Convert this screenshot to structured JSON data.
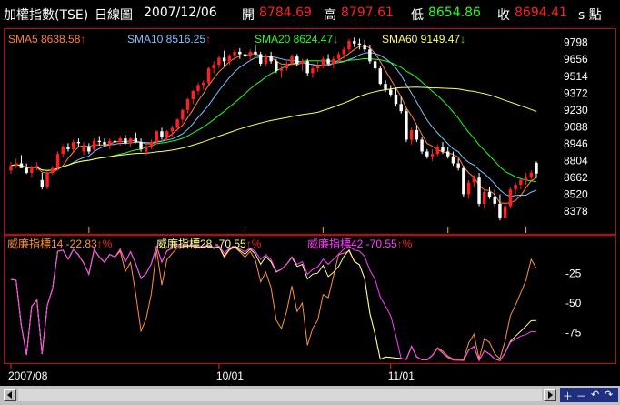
{
  "header": {
    "index_name": "加權指數(TSE)",
    "period": "日線圖",
    "date": "2007/12/06",
    "open_label": "開",
    "open_value": "8784.69",
    "high_label": "高",
    "high_value": "8797.61",
    "low_label": "低",
    "low_value": "8654.86",
    "close_label": "收",
    "close_value": "8694.41",
    "unit": "s 點"
  },
  "colors": {
    "up_candle": "#ff2020",
    "down_candle": "#ffffff",
    "sma5": "#ff8040",
    "sma10": "#80c0ff",
    "sma20": "#20ff20",
    "sma60": "#ffff60",
    "wr14": "#ff9040",
    "wr28": "#ffff90",
    "wr42": "#ff40ff",
    "frame": "#d00010",
    "axis_text": "#ffffff",
    "volume_tick": "#ffb000"
  },
  "icons": {
    "zoom_controls": [
      "zoom-in-icon",
      "zoom-out-icon",
      "undo-icon",
      "redo-icon"
    ]
  },
  "chart_data": [
    {
      "type": "candlestick",
      "legend": [
        {
          "name": "SMA5",
          "value": "8638.58",
          "arrow": "↑"
        },
        {
          "name": "SMA10",
          "value": "8516.25",
          "arrow": "↑"
        },
        {
          "name": "SMA20",
          "value": "8624.47",
          "arrow": "↓"
        },
        {
          "name": "SMA60",
          "value": "9149.47",
          "arrow": "↓"
        }
      ],
      "yticks": [
        9798,
        9656,
        9514,
        9372,
        9230,
        9088,
        8946,
        8804,
        8662,
        8520,
        8378
      ],
      "ylim": [
        8240,
        9880
      ],
      "xticks": [
        {
          "label": "2007/08",
          "index": 0
        },
        {
          "label": "10/01",
          "index": 40
        },
        {
          "label": "11/01",
          "index": 73
        }
      ],
      "candles": [
        [
          8720,
          8790,
          8690,
          8760
        ],
        [
          8760,
          8820,
          8740,
          8780
        ],
        [
          8780,
          8850,
          8760,
          8740
        ],
        [
          8740,
          8780,
          8690,
          8700
        ],
        [
          8700,
          8760,
          8660,
          8750
        ],
        [
          8750,
          8790,
          8720,
          8760
        ],
        [
          8640,
          8700,
          8560,
          8580
        ],
        [
          8580,
          8720,
          8560,
          8700
        ],
        [
          8700,
          8760,
          8680,
          8740
        ],
        [
          8740,
          8880,
          8720,
          8860
        ],
        [
          8860,
          8940,
          8830,
          8920
        ],
        [
          8920,
          8950,
          8880,
          8900
        ],
        [
          8900,
          8980,
          8880,
          8960
        ],
        [
          8960,
          8990,
          8920,
          8950
        ],
        [
          8880,
          8960,
          8850,
          8920
        ],
        [
          8920,
          8950,
          8860,
          8880
        ],
        [
          8900,
          8990,
          8880,
          8970
        ],
        [
          8970,
          9010,
          8930,
          8960
        ],
        [
          8960,
          8990,
          8920,
          8940
        ],
        [
          8940,
          8990,
          8900,
          8970
        ],
        [
          8970,
          9000,
          8930,
          8960
        ],
        [
          8960,
          9010,
          8930,
          8990
        ],
        [
          8990,
          9020,
          8940,
          8950
        ],
        [
          8950,
          9000,
          8920,
          8990
        ],
        [
          8990,
          9040,
          8950,
          8960
        ],
        [
          8960,
          8990,
          8880,
          8900
        ],
        [
          8880,
          8940,
          8850,
          8920
        ],
        [
          8920,
          8980,
          8900,
          8960
        ],
        [
          8960,
          9060,
          8940,
          9050
        ],
        [
          9050,
          9080,
          8980,
          9000
        ],
        [
          9000,
          9060,
          8970,
          9050
        ],
        [
          9050,
          9100,
          9000,
          9080
        ],
        [
          9080,
          9160,
          9050,
          9150
        ],
        [
          9150,
          9240,
          9120,
          9230
        ],
        [
          9230,
          9330,
          9200,
          9320
        ],
        [
          9320,
          9400,
          9280,
          9390
        ],
        [
          9390,
          9460,
          9360,
          9440
        ],
        [
          9440,
          9480,
          9400,
          9460
        ],
        [
          9460,
          9590,
          9440,
          9580
        ],
        [
          9580,
          9640,
          9540,
          9610
        ],
        [
          9610,
          9690,
          9580,
          9670
        ],
        [
          9670,
          9730,
          9600,
          9640
        ],
        [
          9640,
          9700,
          9610,
          9690
        ],
        [
          9690,
          9740,
          9650,
          9720
        ],
        [
          9720,
          9750,
          9660,
          9700
        ],
        [
          9700,
          9760,
          9660,
          9680
        ],
        [
          9680,
          9740,
          9640,
          9720
        ],
        [
          9720,
          9780,
          9690,
          9700
        ],
        [
          9700,
          9720,
          9600,
          9620
        ],
        [
          9620,
          9700,
          9600,
          9680
        ],
        [
          9680,
          9720,
          9620,
          9640
        ],
        [
          9640,
          9660,
          9540,
          9560
        ],
        [
          9560,
          9600,
          9500,
          9580
        ],
        [
          9580,
          9640,
          9560,
          9620
        ],
        [
          9620,
          9700,
          9600,
          9680
        ],
        [
          9680,
          9700,
          9600,
          9620
        ],
        [
          9620,
          9660,
          9560,
          9640
        ],
        [
          9640,
          9660,
          9520,
          9540
        ],
        [
          9540,
          9600,
          9500,
          9580
        ],
        [
          9580,
          9640,
          9550,
          9600
        ],
        [
          9600,
          9680,
          9580,
          9660
        ],
        [
          9660,
          9700,
          9600,
          9620
        ],
        [
          9620,
          9680,
          9580,
          9660
        ],
        [
          9660,
          9720,
          9620,
          9700
        ],
        [
          9700,
          9760,
          9660,
          9740
        ],
        [
          9740,
          9830,
          9720,
          9810
        ],
        [
          9810,
          9840,
          9760,
          9790
        ],
        [
          9790,
          9830,
          9740,
          9780
        ],
        [
          9780,
          9820,
          9720,
          9740
        ],
        [
          9740,
          9780,
          9620,
          9640
        ],
        [
          9640,
          9660,
          9560,
          9580
        ],
        [
          9580,
          9600,
          9440,
          9450
        ],
        [
          9450,
          9480,
          9380,
          9400
        ],
        [
          9400,
          9440,
          9340,
          9360
        ],
        [
          9360,
          9420,
          9260,
          9280
        ],
        [
          9280,
          9340,
          9200,
          9220
        ],
        [
          9220,
          9240,
          8960,
          8980
        ],
        [
          8980,
          9080,
          8940,
          9060
        ],
        [
          9060,
          9100,
          8960,
          8980
        ],
        [
          8980,
          9000,
          8860,
          8880
        ],
        [
          8880,
          8900,
          8820,
          8840
        ],
        [
          8840,
          8900,
          8800,
          8860
        ],
        [
          8860,
          8940,
          8840,
          8920
        ],
        [
          8920,
          8960,
          8860,
          8880
        ],
        [
          8880,
          8920,
          8820,
          8840
        ],
        [
          8840,
          8880,
          8760,
          8780
        ],
        [
          8780,
          8820,
          8720,
          8740
        ],
        [
          8740,
          8760,
          8500,
          8520
        ],
        [
          8520,
          8640,
          8480,
          8620
        ],
        [
          8620,
          8680,
          8580,
          8660
        ],
        [
          8660,
          8700,
          8420,
          8440
        ],
        [
          8440,
          8560,
          8400,
          8540
        ],
        [
          8540,
          8580,
          8480,
          8500
        ],
        [
          8500,
          8560,
          8420,
          8440
        ],
        [
          8440,
          8520,
          8300,
          8320
        ],
        [
          8320,
          8440,
          8300,
          8420
        ],
        [
          8420,
          8580,
          8400,
          8560
        ],
        [
          8560,
          8620,
          8520,
          8600
        ],
        [
          8600,
          8660,
          8560,
          8640
        ],
        [
          8640,
          8700,
          8600,
          8660
        ],
        [
          8660,
          8720,
          8640,
          8700
        ],
        [
          8784.69,
          8797.61,
          8654.86,
          8694.41
        ]
      ]
    },
    {
      "type": "line",
      "legend": [
        {
          "name": "威廉指標14",
          "value": "-22.83",
          "arrow": "↑%"
        },
        {
          "name": "威廉指標28",
          "value": "-70.55",
          "arrow": "↑%"
        },
        {
          "name": "威廉指標42",
          "value": "-70.55",
          "arrow": "↑%"
        }
      ],
      "yticks": [
        -25,
        -50,
        -75
      ],
      "ylim": [
        -100,
        0
      ]
    }
  ]
}
